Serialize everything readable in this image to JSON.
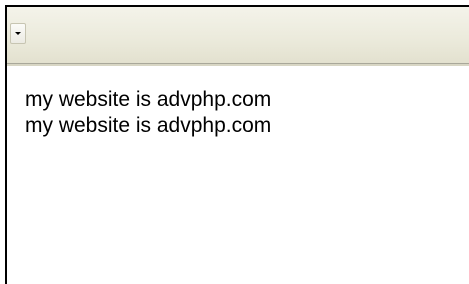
{
  "toolbar": {
    "dropdown_icon": "chevron-down-icon"
  },
  "output": {
    "lines": [
      "my website is advphp.com",
      "my website is advphp.com"
    ]
  }
}
